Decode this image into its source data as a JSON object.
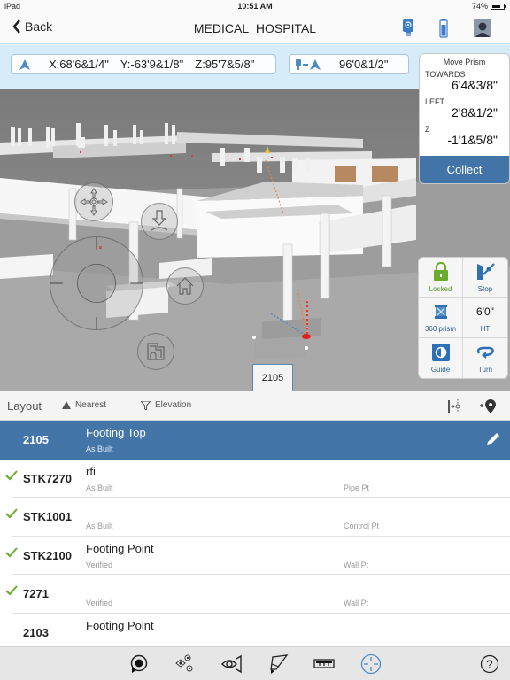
{
  "status_bar": {
    "device": "iPad",
    "time": "10:51 AM",
    "battery": "74%",
    "battery_level": 0.74
  },
  "nav": {
    "back_label": "Back",
    "title": "MEDICAL_HOSPITAL",
    "icons": [
      "instrument-icon",
      "battery-icon",
      "user-avatar-icon"
    ]
  },
  "coords": {
    "x": "X:68'6&1/4\"",
    "y": "Y:-63'9&1/8\"",
    "z": "Z:95'7&5/8\"",
    "distance": "96'0&1/2\""
  },
  "move_prism": {
    "title": "Move Prism",
    "towards_label": "TOWARDS",
    "towards_value": "6'4&3/8\"",
    "left_label": "LEFT",
    "left_value": "2'8&1/2\"",
    "z_label": "Z",
    "z_value": "-1'1&5/8\"",
    "collect_label": "Collect"
  },
  "controls": {
    "locked": "Locked",
    "stop": "Stop",
    "prism": "360 prism",
    "ht_value": "6'0\"",
    "ht_label": "HT",
    "guide": "Guide",
    "turn": "Turn"
  },
  "callout": {
    "point_id": "2105"
  },
  "colors": {
    "accent": "#4375a8",
    "check": "#6aab2e",
    "locked_green": "#6aab2e",
    "coordbar_bg": "#d6edf9"
  },
  "filter_bar": {
    "title": "Layout",
    "sort_label": "Nearest",
    "filter_label": "Elevation"
  },
  "points": [
    {
      "id": "2105",
      "name": "Footing Top",
      "status": "As Built",
      "type": "",
      "checked": false,
      "selected": true
    },
    {
      "id": "STK7270",
      "name": "rfi",
      "status": "As Built",
      "type": "Pipe Pt",
      "checked": true,
      "selected": false
    },
    {
      "id": "STK1001",
      "name": "",
      "status": "As Built",
      "type": "Control Pt",
      "checked": true,
      "selected": false
    },
    {
      "id": "STK2100",
      "name": "Footing Point",
      "status": "Verified",
      "type": "Wall Pt",
      "checked": true,
      "selected": false
    },
    {
      "id": "7271",
      "name": "",
      "status": "Verified",
      "type": "Wall Pt",
      "checked": true,
      "selected": false
    },
    {
      "id": "2103",
      "name": "Footing Point",
      "status": "",
      "type": "",
      "checked": false,
      "selected": false
    }
  ],
  "toolbar": {
    "icons": [
      "point-marker-icon",
      "objects-icon",
      "view-icon",
      "draw-icon",
      "measure-icon",
      "crosshair-icon",
      "help-icon"
    ],
    "help_label": "?"
  }
}
